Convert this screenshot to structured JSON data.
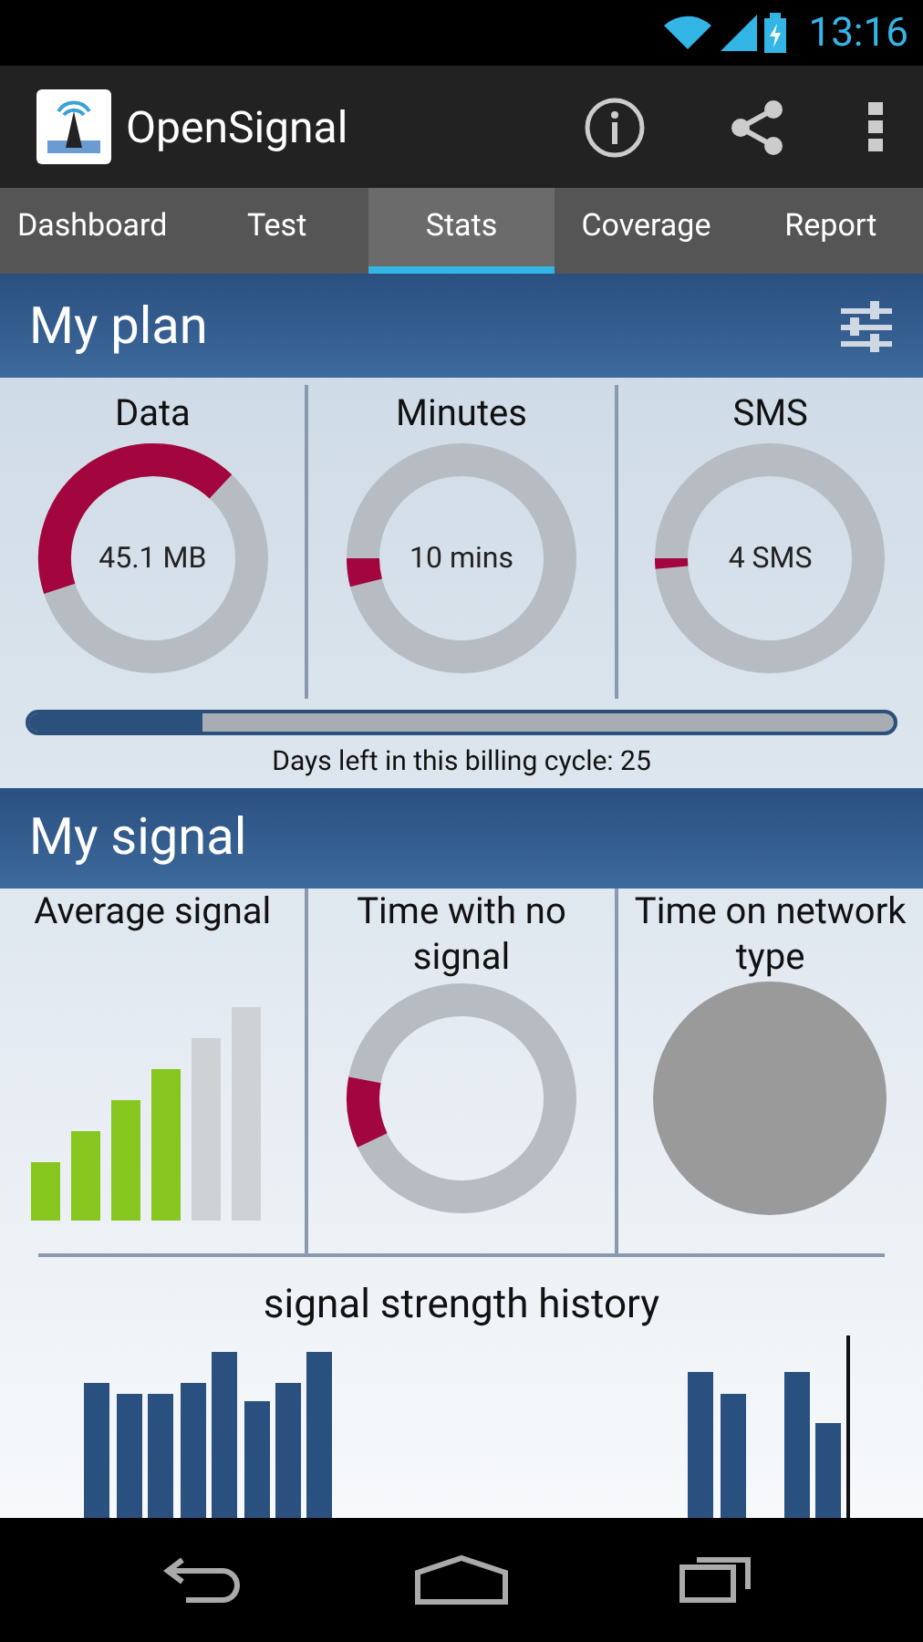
{
  "status_bar": {
    "time": "13:16"
  },
  "app_bar": {
    "title": "OpenSignal"
  },
  "tabs": [
    {
      "label": "Dashboard",
      "selected": false
    },
    {
      "label": "Test",
      "selected": false
    },
    {
      "label": "Stats",
      "selected": true
    },
    {
      "label": "Coverage",
      "selected": false
    },
    {
      "label": "Report",
      "selected": false
    }
  ],
  "plan": {
    "title": "My plan",
    "gauges": [
      {
        "label": "Data",
        "reading": "45.1 MB"
      },
      {
        "label": "Minutes",
        "reading": "10 mins"
      },
      {
        "label": "SMS",
        "reading": "4 SMS"
      }
    ],
    "billing": {
      "level": 0.2,
      "text": "Days left in this billing cycle: 25"
    }
  },
  "signal": {
    "title": "My signal",
    "panels": [
      {
        "kind": "bars",
        "label": "Average signal",
        "level": 0.67
      },
      {
        "kind": "donut",
        "label": "Time with no signal"
      },
      {
        "kind": "pie",
        "label": "Time on network type"
      }
    ],
    "history_title": "signal strength history"
  }
}
